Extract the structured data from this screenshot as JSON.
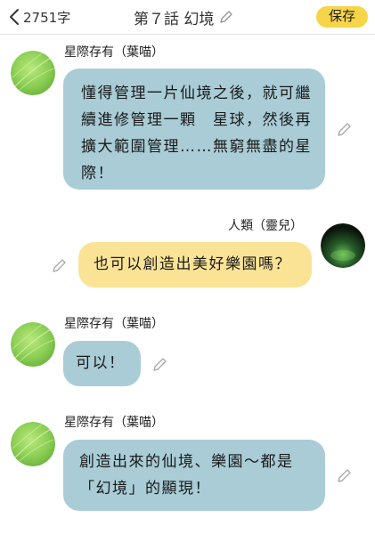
{
  "header": {
    "word_count": "2751字",
    "title": "第７話 幻境",
    "save_label": "保存"
  },
  "messages": [
    {
      "sender": "星際存有（葉喵）",
      "text": "懂得管理一片仙境之後，就可繼續進修管理一顆　星球，然後再擴大範圍管理……無窮無盡的星際！",
      "side": "left"
    },
    {
      "sender": "人類（靈兒）",
      "text": "也可以創造出美好樂園嗎？",
      "side": "right"
    },
    {
      "sender": "星際存有（葉喵）",
      "text": "可以！",
      "side": "left"
    },
    {
      "sender": "星際存有（葉喵）",
      "text": "創造出來的仙境、樂園～都是「幻境」的顯現！",
      "side": "left"
    }
  ],
  "icons": {
    "back": "chevron-left-icon",
    "edit": "pencil-icon"
  },
  "colors": {
    "save_button": "#f7d548",
    "left_bubble": "#a9ccd6",
    "right_bubble": "#fbe396"
  }
}
